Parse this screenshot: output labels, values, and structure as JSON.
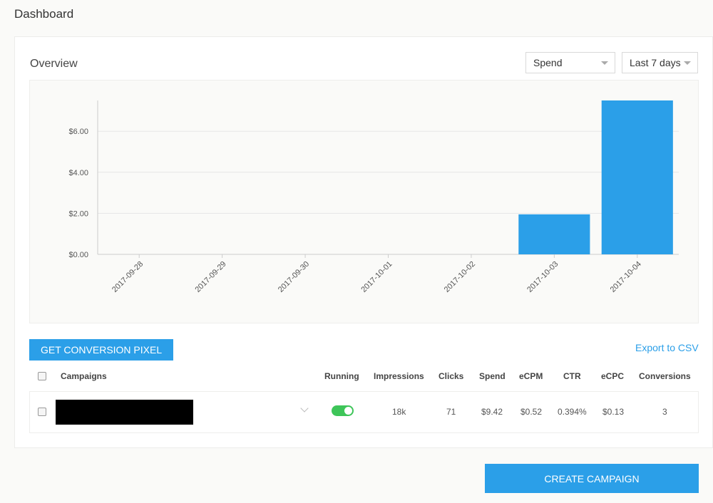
{
  "page": {
    "title": "Dashboard"
  },
  "overview": {
    "title": "Overview",
    "metric_select": "Spend",
    "range_select": "Last 7 days"
  },
  "actions": {
    "pixel_button": "GET CONVERSION PIXEL",
    "export_link": "Export to CSV",
    "create_button": "CREATE CAMPAIGN"
  },
  "table": {
    "headers": {
      "campaigns": "Campaigns",
      "running": "Running",
      "impressions": "Impressions",
      "clicks": "Clicks",
      "spend": "Spend",
      "ecpm": "eCPM",
      "ctr": "CTR",
      "ecpc": "eCPC",
      "conversions": "Conversions"
    },
    "rows": [
      {
        "running": true,
        "impressions": "18k",
        "clicks": "71",
        "spend": "$9.42",
        "ecpm": "$0.52",
        "ctr": "0.394%",
        "ecpc": "$0.13",
        "conversions": "3"
      }
    ]
  },
  "colors": {
    "accent": "#2b9fe8",
    "toggle_on": "#3ec559",
    "bar": "#2b9fe8"
  },
  "chart_data": {
    "type": "bar",
    "categories": [
      "2017-09-28",
      "2017-09-29",
      "2017-09-30",
      "2017-10-01",
      "2017-10-02",
      "2017-10-03",
      "2017-10-04"
    ],
    "values": [
      0,
      0,
      0,
      0,
      0,
      1.95,
      7.5
    ],
    "yticks": [
      "$0.00",
      "$2.00",
      "$4.00",
      "$6.00"
    ],
    "ytick_values": [
      0,
      2,
      4,
      6
    ],
    "ylim": [
      0,
      7.5
    ],
    "grid": true,
    "legend": "none"
  }
}
